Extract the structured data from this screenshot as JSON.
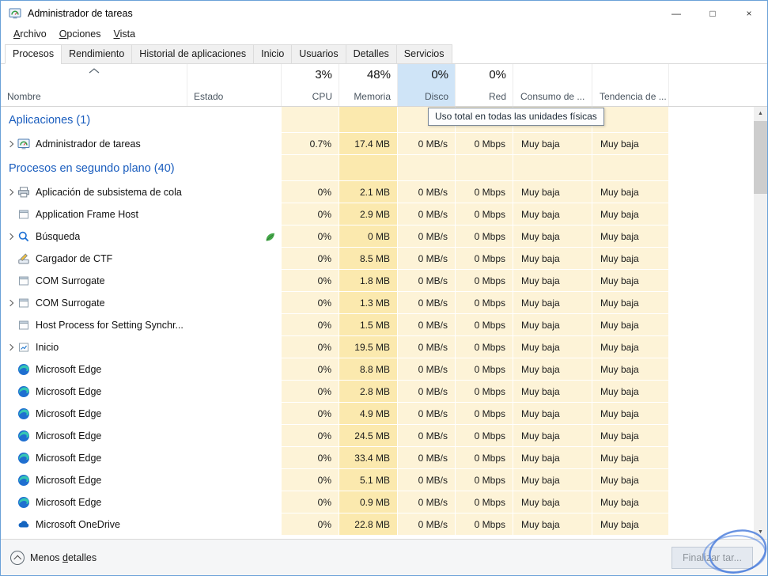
{
  "window": {
    "title": "Administrador de tareas",
    "controls": {
      "minimize": "—",
      "maximize": "□",
      "close": "×"
    }
  },
  "menu": {
    "items": [
      "Archivo",
      "Opciones",
      "Vista"
    ]
  },
  "tabs": {
    "items": [
      "Procesos",
      "Rendimiento",
      "Historial de aplicaciones",
      "Inicio",
      "Usuarios",
      "Detalles",
      "Servicios"
    ],
    "active_index": 0
  },
  "columns": {
    "name_label": "Nombre",
    "status_label": "Estado",
    "stats": [
      {
        "value": "3%",
        "label": "CPU",
        "selected": false
      },
      {
        "value": "48%",
        "label": "Memoria",
        "selected": false
      },
      {
        "value": "0%",
        "label": "Disco",
        "selected": true
      },
      {
        "value": "0%",
        "label": "Red",
        "selected": false
      }
    ],
    "extras": [
      "Consumo de ...",
      "Tendencia de ..."
    ]
  },
  "tooltip": {
    "text": "Uso total en todas las unidades físicas"
  },
  "processes": [
    {
      "type": "group",
      "label": "Aplicaciones (1)"
    },
    {
      "type": "process",
      "name": "Administrador de tareas",
      "icon": "taskmanager",
      "expandable": true,
      "eco_leaf": false,
      "cpu": "0.7%",
      "memory": "17.4 MB",
      "disk": "0 MB/s",
      "network": "0 Mbps",
      "power_usage": "Muy baja",
      "power_trend": "Muy baja"
    },
    {
      "type": "group",
      "label": "Procesos en segundo plano (40)"
    },
    {
      "type": "process",
      "name": "Aplicación de subsistema de cola",
      "icon": "print-queue",
      "expandable": true,
      "eco_leaf": false,
      "cpu": "0%",
      "memory": "2.1 MB",
      "disk": "0 MB/s",
      "network": "0 Mbps",
      "power_usage": "Muy baja",
      "power_trend": "Muy baja"
    },
    {
      "type": "process",
      "name": "Application Frame Host",
      "icon": "app-frame",
      "expandable": false,
      "eco_leaf": false,
      "cpu": "0%",
      "memory": "2.9 MB",
      "disk": "0 MB/s",
      "network": "0 Mbps",
      "power_usage": "Muy baja",
      "power_trend": "Muy baja"
    },
    {
      "type": "process",
      "name": "Búsqueda",
      "icon": "search",
      "expandable": true,
      "eco_leaf": true,
      "cpu": "0%",
      "memory": "0 MB",
      "disk": "0 MB/s",
      "network": "0 Mbps",
      "power_usage": "Muy baja",
      "power_trend": "Muy baja"
    },
    {
      "type": "process",
      "name": "Cargador de CTF",
      "icon": "ctf-loader",
      "expandable": false,
      "eco_leaf": false,
      "cpu": "0%",
      "memory": "8.5 MB",
      "disk": "0 MB/s",
      "network": "0 Mbps",
      "power_usage": "Muy baja",
      "power_trend": "Muy baja"
    },
    {
      "type": "process",
      "name": "COM Surrogate",
      "icon": "com-surrogate",
      "expandable": false,
      "eco_leaf": false,
      "cpu": "0%",
      "memory": "1.8 MB",
      "disk": "0 MB/s",
      "network": "0 Mbps",
      "power_usage": "Muy baja",
      "power_trend": "Muy baja"
    },
    {
      "type": "process",
      "name": "COM Surrogate",
      "icon": "com-surrogate",
      "expandable": true,
      "eco_leaf": false,
      "cpu": "0%",
      "memory": "1.3 MB",
      "disk": "0 MB/s",
      "network": "0 Mbps",
      "power_usage": "Muy baja",
      "power_trend": "Muy baja"
    },
    {
      "type": "process",
      "name": "Host Process for Setting Synchr...",
      "icon": "host-process",
      "expandable": false,
      "eco_leaf": false,
      "cpu": "0%",
      "memory": "1.5 MB",
      "disk": "0 MB/s",
      "network": "0 Mbps",
      "power_usage": "Muy baja",
      "power_trend": "Muy baja"
    },
    {
      "type": "process",
      "name": "Inicio",
      "icon": "startup",
      "expandable": true,
      "eco_leaf": false,
      "cpu": "0%",
      "memory": "19.5 MB",
      "disk": "0 MB/s",
      "network": "0 Mbps",
      "power_usage": "Muy baja",
      "power_trend": "Muy baja"
    },
    {
      "type": "process",
      "name": "Microsoft Edge",
      "icon": "edge",
      "expandable": false,
      "eco_leaf": false,
      "cpu": "0%",
      "memory": "8.8 MB",
      "disk": "0 MB/s",
      "network": "0 Mbps",
      "power_usage": "Muy baja",
      "power_trend": "Muy baja"
    },
    {
      "type": "process",
      "name": "Microsoft Edge",
      "icon": "edge",
      "expandable": false,
      "eco_leaf": false,
      "cpu": "0%",
      "memory": "2.8 MB",
      "disk": "0 MB/s",
      "network": "0 Mbps",
      "power_usage": "Muy baja",
      "power_trend": "Muy baja"
    },
    {
      "type": "process",
      "name": "Microsoft Edge",
      "icon": "edge",
      "expandable": false,
      "eco_leaf": false,
      "cpu": "0%",
      "memory": "4.9 MB",
      "disk": "0 MB/s",
      "network": "0 Mbps",
      "power_usage": "Muy baja",
      "power_trend": "Muy baja"
    },
    {
      "type": "process",
      "name": "Microsoft Edge",
      "icon": "edge",
      "expandable": false,
      "eco_leaf": false,
      "cpu": "0%",
      "memory": "24.5 MB",
      "disk": "0 MB/s",
      "network": "0 Mbps",
      "power_usage": "Muy baja",
      "power_trend": "Muy baja"
    },
    {
      "type": "process",
      "name": "Microsoft Edge",
      "icon": "edge",
      "expandable": false,
      "eco_leaf": false,
      "cpu": "0%",
      "memory": "33.4 MB",
      "disk": "0 MB/s",
      "network": "0 Mbps",
      "power_usage": "Muy baja",
      "power_trend": "Muy baja"
    },
    {
      "type": "process",
      "name": "Microsoft Edge",
      "icon": "edge",
      "expandable": false,
      "eco_leaf": false,
      "cpu": "0%",
      "memory": "5.1 MB",
      "disk": "0 MB/s",
      "network": "0 Mbps",
      "power_usage": "Muy baja",
      "power_trend": "Muy baja"
    },
    {
      "type": "process",
      "name": "Microsoft Edge",
      "icon": "edge",
      "expandable": false,
      "eco_leaf": false,
      "cpu": "0%",
      "memory": "0.9 MB",
      "disk": "0 MB/s",
      "network": "0 Mbps",
      "power_usage": "Muy baja",
      "power_trend": "Muy baja"
    },
    {
      "type": "process",
      "name": "Microsoft OneDrive",
      "icon": "onedrive",
      "expandable": false,
      "eco_leaf": false,
      "cpu": "0%",
      "memory": "22.8 MB",
      "disk": "0 MB/s",
      "network": "0 Mbps",
      "power_usage": "Muy baja",
      "power_trend": "Muy baja"
    }
  ],
  "statusbar": {
    "toggle_pre": "Menos ",
    "toggle_accel": "d",
    "toggle_post": "etalles",
    "end_task_label": "Finalizar tar..."
  },
  "colors": {
    "group_text": "#1a5dbe",
    "heat_cell": "#fdf3d7",
    "heat_memory": "#fbe9ae",
    "disk_header_highlight": "#cfe4f7",
    "eco_leaf": "#45a84a",
    "annotation": "#4d7fdc"
  }
}
